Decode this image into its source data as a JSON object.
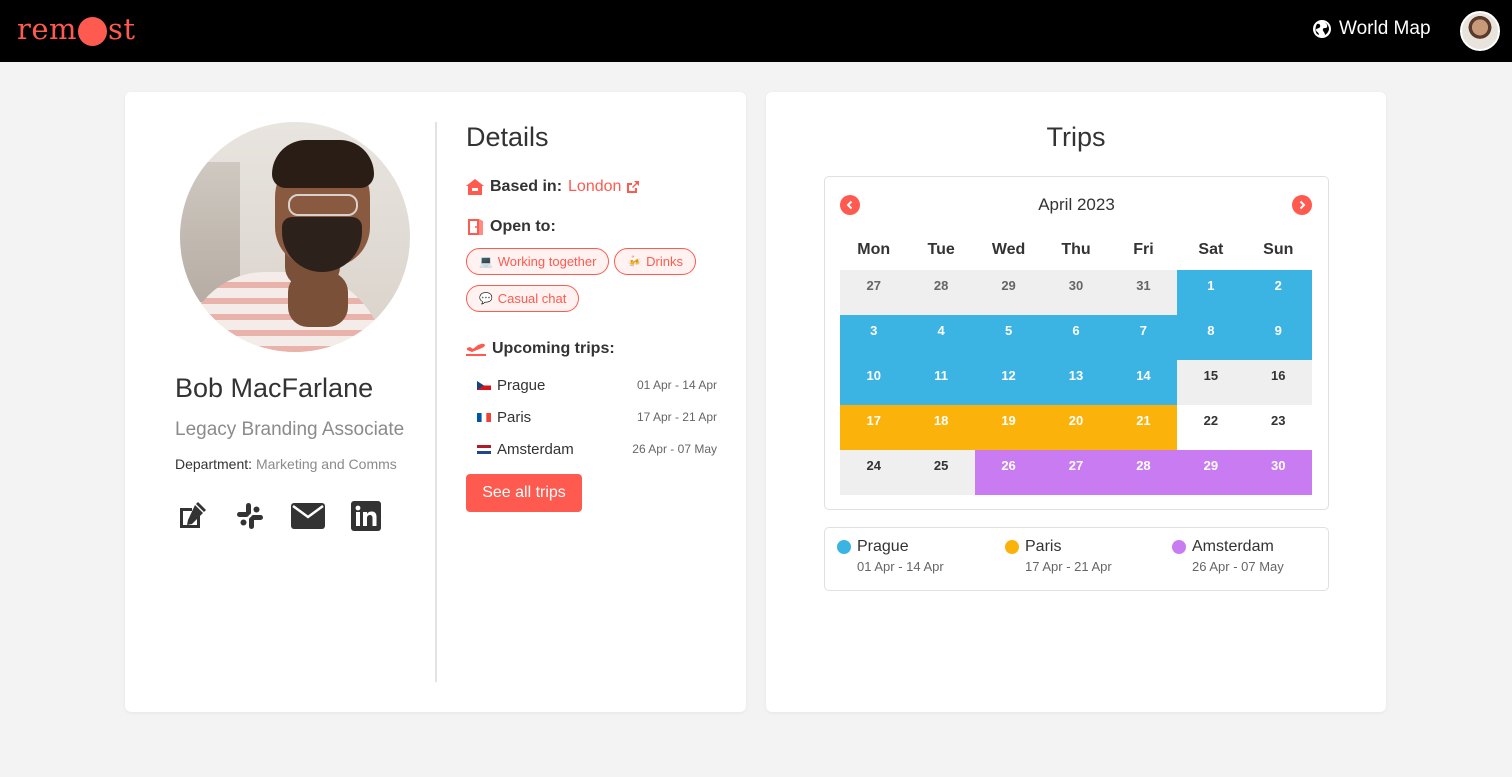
{
  "header": {
    "logo": "rem●st",
    "logo_pre": "rem",
    "logo_post": "st",
    "world_map_label": "World Map",
    "accent_color": "#ff5a4f"
  },
  "profile": {
    "name": "Bob MacFarlane",
    "role": "Legacy Branding Associate",
    "department_label": "Department:",
    "department_value": "Marketing and Comms",
    "social_icons": [
      "edit-icon",
      "slack-icon",
      "email-icon",
      "linkedin-icon"
    ]
  },
  "details": {
    "title": "Details",
    "based_in_label": "Based in:",
    "based_in_value": "London",
    "open_to_label": "Open to:",
    "open_to": [
      {
        "emoji": "💻",
        "label": "Working together"
      },
      {
        "emoji": "🍻",
        "label": "Drinks"
      },
      {
        "emoji": "💬",
        "label": "Casual chat"
      }
    ],
    "upcoming_label": "Upcoming trips:",
    "trips": [
      {
        "city": "Prague",
        "dates": "01 Apr - 14 Apr",
        "flag": "cz"
      },
      {
        "city": "Paris",
        "dates": "17 Apr - 21 Apr",
        "flag": "fr"
      },
      {
        "city": "Amsterdam",
        "dates": "26 Apr - 07 May",
        "flag": "nl"
      }
    ],
    "see_all_label": "See all trips"
  },
  "trips_panel": {
    "title": "Trips",
    "month": "April 2023",
    "weekdays": [
      "Mon",
      "Tue",
      "Wed",
      "Thu",
      "Fri",
      "Sat",
      "Sun"
    ],
    "colors": {
      "prague": "#3bb3e3",
      "paris": "#fbb20b",
      "amsterdam": "#c97cf2",
      "outside": "#efefef",
      "none": "#ffffff"
    },
    "days": [
      {
        "d": "27",
        "t": "outside"
      },
      {
        "d": "28",
        "t": "outside"
      },
      {
        "d": "29",
        "t": "outside"
      },
      {
        "d": "30",
        "t": "outside"
      },
      {
        "d": "31",
        "t": "outside"
      },
      {
        "d": "1",
        "t": "prague"
      },
      {
        "d": "2",
        "t": "prague"
      },
      {
        "d": "3",
        "t": "prague"
      },
      {
        "d": "4",
        "t": "prague"
      },
      {
        "d": "5",
        "t": "prague"
      },
      {
        "d": "6",
        "t": "prague"
      },
      {
        "d": "7",
        "t": "prague"
      },
      {
        "d": "8",
        "t": "prague"
      },
      {
        "d": "9",
        "t": "prague"
      },
      {
        "d": "10",
        "t": "prague"
      },
      {
        "d": "11",
        "t": "prague"
      },
      {
        "d": "12",
        "t": "prague"
      },
      {
        "d": "13",
        "t": "prague"
      },
      {
        "d": "14",
        "t": "prague"
      },
      {
        "d": "15",
        "t": "weekend"
      },
      {
        "d": "16",
        "t": "weekend"
      },
      {
        "d": "17",
        "t": "paris"
      },
      {
        "d": "18",
        "t": "paris"
      },
      {
        "d": "19",
        "t": "paris"
      },
      {
        "d": "20",
        "t": "paris"
      },
      {
        "d": "21",
        "t": "paris"
      },
      {
        "d": "22",
        "t": "none"
      },
      {
        "d": "23",
        "t": "none"
      },
      {
        "d": "24",
        "t": "weekend"
      },
      {
        "d": "25",
        "t": "weekend"
      },
      {
        "d": "26",
        "t": "amsterdam"
      },
      {
        "d": "27",
        "t": "amsterdam"
      },
      {
        "d": "28",
        "t": "amsterdam"
      },
      {
        "d": "29",
        "t": "amsterdam"
      },
      {
        "d": "30",
        "t": "amsterdam"
      }
    ],
    "legend": [
      {
        "city": "Prague",
        "dates": "01 Apr - 14 Apr",
        "color": "#3bb3e3"
      },
      {
        "city": "Paris",
        "dates": "17 Apr - 21 Apr",
        "color": "#fbb20b"
      },
      {
        "city": "Amsterdam",
        "dates": "26 Apr - 07 May",
        "color": "#c97cf2"
      }
    ]
  }
}
